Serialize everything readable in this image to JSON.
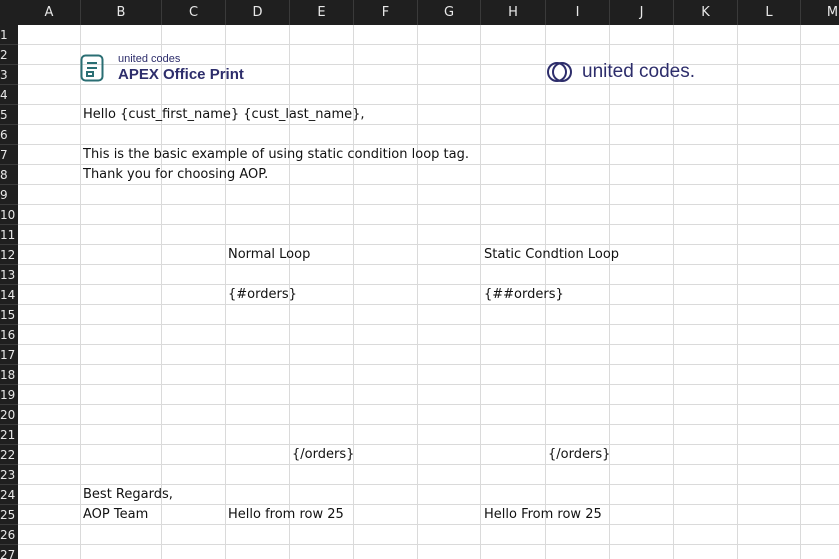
{
  "spreadsheet": {
    "columns": [
      "A",
      "B",
      "C",
      "D",
      "E",
      "F",
      "G",
      "H",
      "I",
      "J",
      "K",
      "L",
      "M"
    ],
    "rows": [
      "1",
      "2",
      "3",
      "4",
      "5",
      "6",
      "7",
      "8",
      "9",
      "10",
      "11",
      "12",
      "13",
      "14",
      "15",
      "16",
      "17",
      "18",
      "19",
      "20",
      "21",
      "22",
      "23",
      "24",
      "25",
      "26",
      "27"
    ]
  },
  "logos": {
    "left_small": "united codes",
    "left_big": "APEX Office Print",
    "right": "united codes."
  },
  "cells": {
    "b5": "Hello {cust_first_name} {cust_last_name},",
    "b7": "This is the basic example of using static condition loop tag.",
    "b8": "Thank you for choosing AOP.",
    "d12": "Normal Loop",
    "h12": "Static Condtion Loop",
    "d14": "{#orders}",
    "h14": "{##orders}",
    "e22": "{/orders}",
    "i22": "{/orders}",
    "b24": "Best Regards,",
    "b25": "AOP Team",
    "d25": "Hello from row 25",
    "h25": "Hello From row 25"
  },
  "colors": {
    "header_bg": "#1f1f1f",
    "grid": "#dadada",
    "brand": "#2d2d6b"
  }
}
